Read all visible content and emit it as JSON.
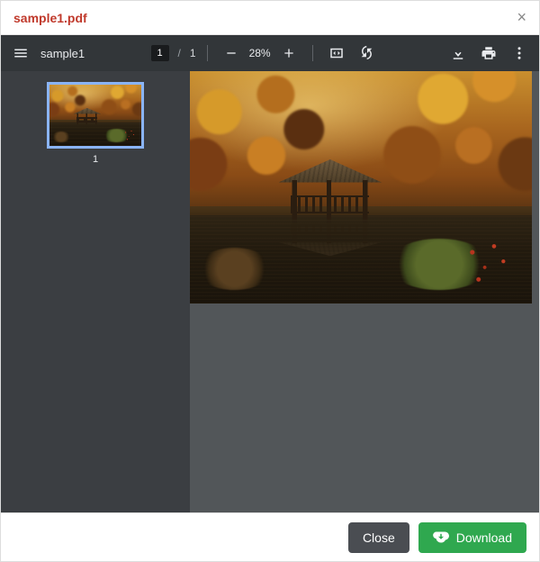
{
  "modal": {
    "title": "sample1.pdf"
  },
  "toolbar": {
    "doc_title": "sample1",
    "current_page": "1",
    "total_pages": "1",
    "zoom_label": "28%"
  },
  "sidebar": {
    "thumb_number": "1"
  },
  "footer": {
    "close_label": "Close",
    "download_label": "Download"
  }
}
